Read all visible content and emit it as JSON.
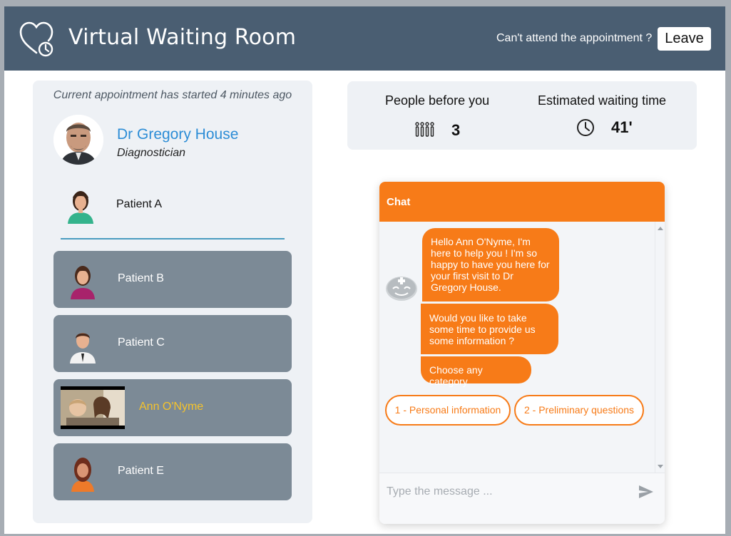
{
  "header": {
    "title": "Virtual Waiting Room",
    "cant_attend": "Can't attend the appointment ?",
    "leave_label": "Leave"
  },
  "appointment": {
    "status": "Current appointment has started 4 minutes ago",
    "doctor_name": "Dr Gregory House",
    "doctor_role": "Diagnostician",
    "current_patient": "Patient A"
  },
  "queue": [
    {
      "label": "Patient B",
      "avatar": "woman-avatar-icon"
    },
    {
      "label": "Patient C",
      "avatar": "man-avatar-icon"
    },
    {
      "label": "Ann O'Nyme",
      "avatar": "video-thumbnail",
      "is_me": true
    },
    {
      "label": "Patient E",
      "avatar": "girl-avatar-icon"
    }
  ],
  "stats": {
    "people_before_label": "People before you",
    "people_before_value": "3",
    "wait_label": "Estimated waiting time",
    "wait_value": "41'"
  },
  "chat": {
    "title": "Chat",
    "messages": [
      "Hello Ann O'Nyme, I'm here to help you ! I'm so happy to have you here for your first visit to Dr Gregory House.",
      "Would you like to take some time to provide us some information ?",
      "Choose any category"
    ],
    "options": [
      "1 - Personal information",
      "2 - Preliminary questions"
    ],
    "input_placeholder": "Type the message ..."
  },
  "colors": {
    "header_bg": "#4a5e72",
    "accent_orange": "#f77b18",
    "doctor_blue": "#2d8dd6",
    "my_name_yellow": "#f5c32c",
    "queue_card": "#7c8a96",
    "panel_bg": "#eef1f5"
  }
}
